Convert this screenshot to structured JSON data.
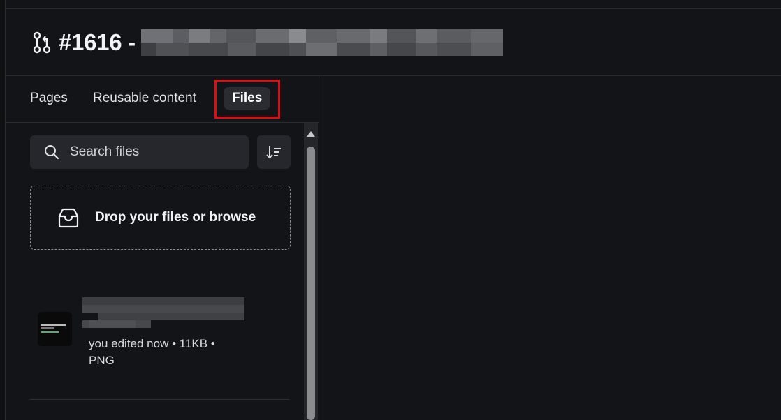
{
  "header": {
    "title": "#1616 - ",
    "title_icon": "git-branch-icon"
  },
  "tabs": [
    {
      "label": "Pages",
      "active": false
    },
    {
      "label": "Reusable content",
      "active": false
    },
    {
      "label": "Files",
      "active": true
    }
  ],
  "search": {
    "placeholder": "Search files",
    "icon": "search-icon"
  },
  "sort_button": {
    "icon": "sort-icon"
  },
  "dropzone": {
    "label": "Drop your files or browse",
    "icon": "inbox-icon"
  },
  "files": [
    {
      "meta_line1": "you edited now • 11KB •",
      "meta_line2": "PNG"
    }
  ],
  "colors": {
    "background": "#131417",
    "panel": "#25272c",
    "highlight": "#d90f15"
  }
}
